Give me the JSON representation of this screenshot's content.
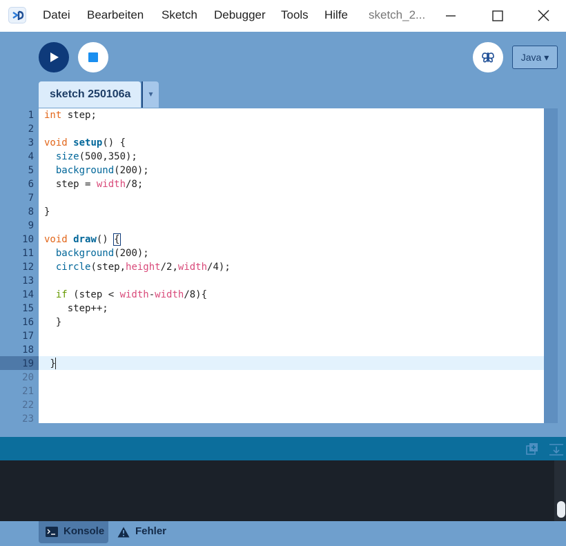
{
  "menu": {
    "items": [
      "Datei",
      "Bearbeiten",
      "Sketch",
      "Debugger",
      "Tools",
      "Hilfe"
    ],
    "window_title": "sketch_2..."
  },
  "toolbar": {
    "mode": "Java ▾"
  },
  "tabs": [
    {
      "label": "sketch 250106a",
      "active": true
    }
  ],
  "tab_menu_glyph": "▾",
  "editor": {
    "active_line": 19,
    "line_numbers": [
      "1",
      "2",
      "3",
      "4",
      "5",
      "6",
      "7",
      "8",
      "9",
      "10",
      "11",
      "12",
      "13",
      "14",
      "15",
      "16",
      "17",
      "18",
      "19",
      "20",
      "21",
      "22",
      "23"
    ],
    "code": [
      "int step;",
      "",
      "void setup() {",
      "  size(500,350);",
      "  background(200);",
      "  step = width/8;",
      "",
      "}",
      "",
      "void draw() {",
      "  background(200);",
      "  circle(step,height/2,width/4);",
      "",
      "  if (step < width-width/8){",
      "    step++;",
      "  }",
      "",
      "",
      " }"
    ]
  },
  "console": {
    "tabs": [
      {
        "label": "Konsole",
        "icon": "terminal-icon",
        "active": true
      },
      {
        "label": "Fehler",
        "icon": "warning-icon",
        "active": false
      }
    ]
  },
  "colors": {
    "background": "#6f9fcd",
    "run_button": "#0e3a7a",
    "stop_square": "#1a8ff0",
    "console_header": "#0c6e9c",
    "console_bg": "#1b2129",
    "keyword": "#e2661a",
    "function": "#006699",
    "variable": "#d94a7a",
    "control": "#669900"
  }
}
